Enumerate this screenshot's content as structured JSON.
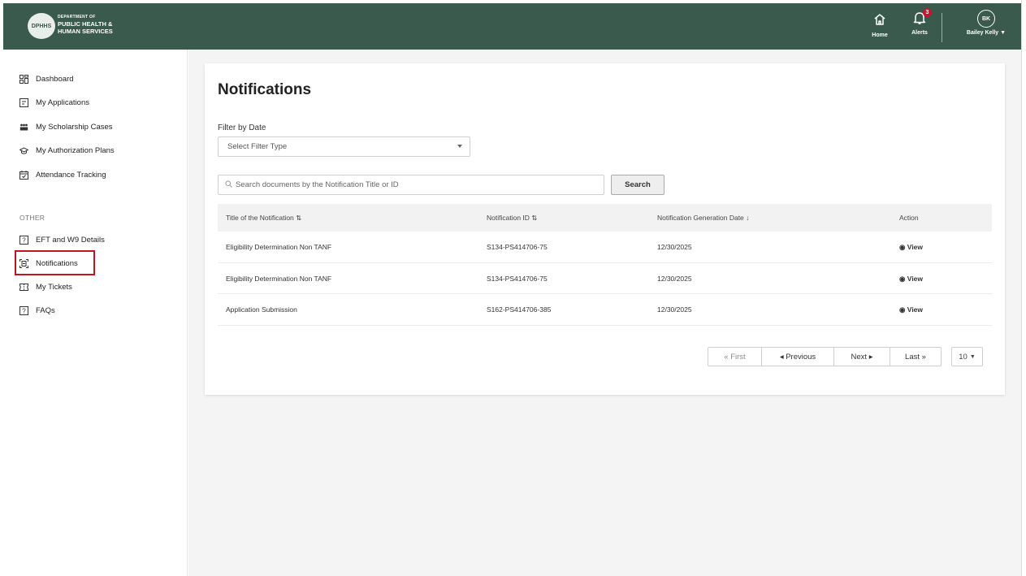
{
  "header": {
    "logo_seal": "DPHHS",
    "logo_line1": "DEPARTMENT OF",
    "logo_line2": "PUBLIC HEALTH &",
    "logo_line3": "HUMAN SERVICES",
    "home_label": "Home",
    "alerts_label": "Alerts",
    "alerts_count": "3",
    "user_initials": "BK",
    "user_name": "Bailey Kelly"
  },
  "sidebar": {
    "items": [
      {
        "label": "Dashboard",
        "icon": "dashboard-icon"
      },
      {
        "label": "My Applications",
        "icon": "document-icon"
      },
      {
        "label": "My Scholarship Cases",
        "icon": "people-icon"
      },
      {
        "label": "My Authorization Plans",
        "icon": "graduation-cap-icon"
      },
      {
        "label": "Attendance Tracking",
        "icon": "calendar-icon"
      }
    ],
    "section_label": "OTHER",
    "other_items": [
      {
        "label": "EFT and W9 Details",
        "icon": "question-box-icon"
      },
      {
        "label": "Notifications",
        "icon": "notification-icon"
      },
      {
        "label": "My Tickets",
        "icon": "ticket-icon"
      },
      {
        "label": "FAQs",
        "icon": "question-box-icon"
      }
    ]
  },
  "main": {
    "title": "Notifications",
    "filter_label": "Filter by Date",
    "filter_placeholder": "Select Filter Type",
    "search_placeholder": "Search documents by the Notification Title or ID",
    "search_button": "Search",
    "table": {
      "headers": [
        "Title of the Notification",
        "Notification ID",
        "Notification Generation Date",
        "Action"
      ],
      "rows": [
        {
          "title": "Eligibility Determination Non TANF",
          "id": "S134-PS414706-75",
          "date": "12/30/2025",
          "action": "View"
        },
        {
          "title": "Eligibility Determination Non TANF",
          "id": "S134-PS414706-75",
          "date": "12/30/2025",
          "action": "View"
        },
        {
          "title": "Application Submission",
          "id": "S162-PS414706-385",
          "date": "12/30/2025",
          "action": "View"
        }
      ]
    },
    "pagination": {
      "first": "« First",
      "previous": "◂ Previous",
      "next": "Next ▸",
      "last": "Last »",
      "per_page": "10"
    }
  },
  "colors": {
    "header_bg": "#395a4c",
    "badge": "#c9142d",
    "active_outline": "#c01424"
  }
}
